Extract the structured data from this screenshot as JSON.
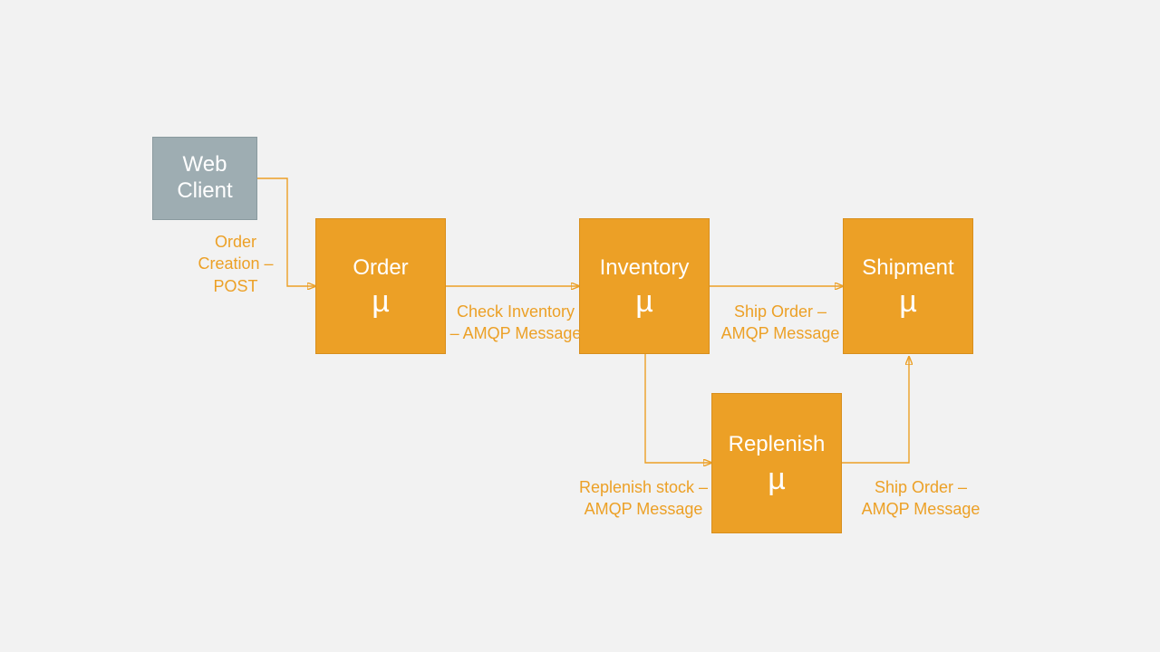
{
  "nodes": {
    "web_client": {
      "label": "Web\nClient"
    },
    "order": {
      "label": "Order",
      "mu": "µ"
    },
    "inventory": {
      "label": "Inventory",
      "mu": "µ"
    },
    "shipment": {
      "label": "Shipment",
      "mu": "µ"
    },
    "replenish": {
      "label": "Replenish",
      "mu": "µ"
    }
  },
  "edges": {
    "web_to_order": "Order\nCreation –\nPOST",
    "order_to_inventory": "Check Inventory\n– AMQP Message",
    "inventory_to_shipment": "Ship Order –\nAMQP Message",
    "inventory_to_replenish": "Replenish stock –\nAMQP Message",
    "replenish_to_shipment": "Ship Order –\nAMQP Message"
  },
  "colors": {
    "accent": "#eca026",
    "gray_box": "#9eadb2",
    "background": "#f2f2f2"
  }
}
